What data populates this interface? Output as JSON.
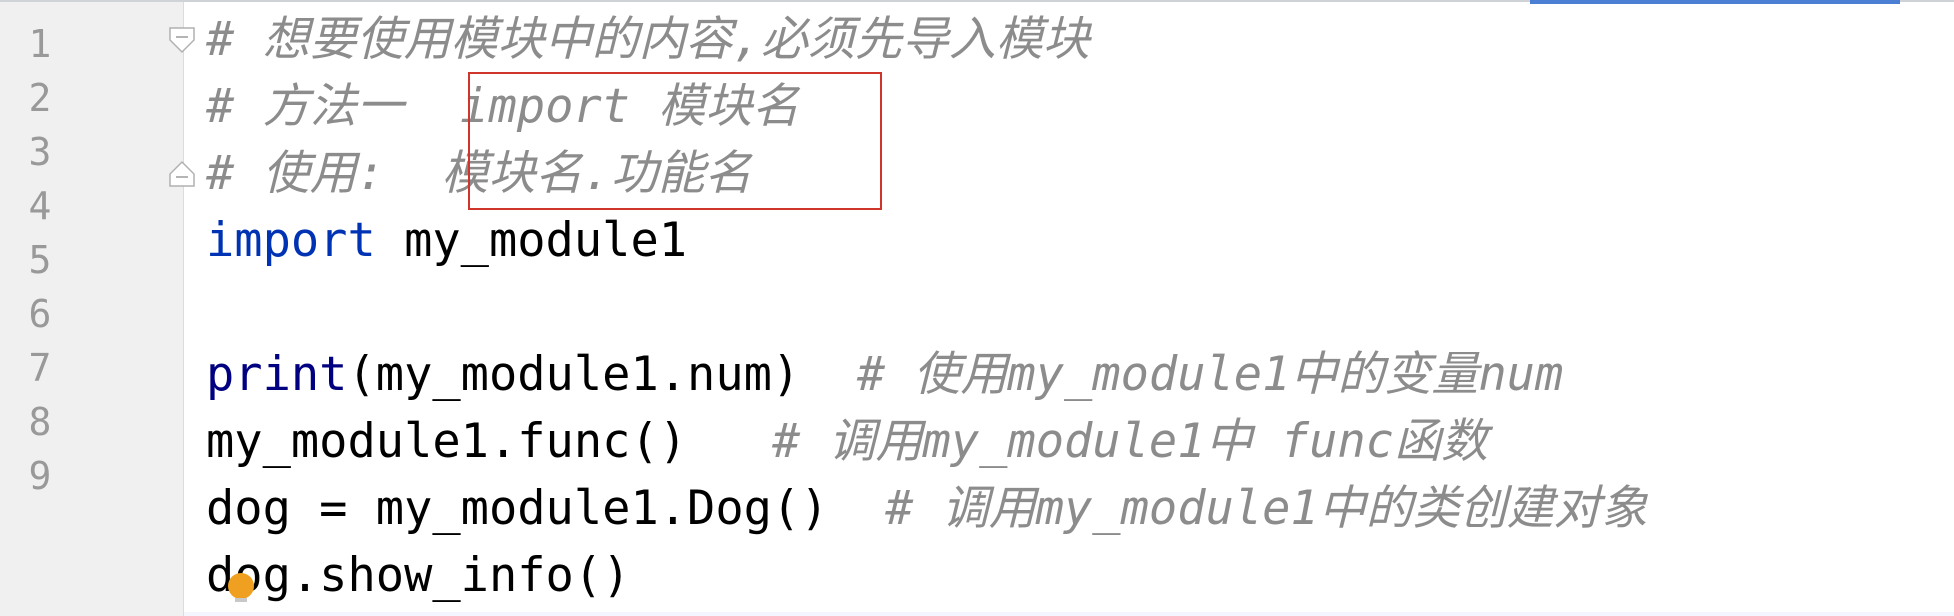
{
  "editor": {
    "line_numbers": [
      "1",
      "2",
      "3",
      "4",
      "5",
      "6",
      "7",
      "8",
      "9"
    ],
    "lines": [
      {
        "segments": [
          {
            "kind": "comment",
            "text": "# 想要使用模块中的内容,必须先导入模块"
          }
        ]
      },
      {
        "segments": [
          {
            "kind": "comment",
            "text": "# 方法一  import 模块名"
          }
        ]
      },
      {
        "segments": [
          {
            "kind": "comment",
            "text": "# 使用:  模块名.功能名"
          }
        ]
      },
      {
        "segments": [
          {
            "kind": "keyword",
            "text": "import"
          },
          {
            "kind": "plain",
            "text": " my_module1"
          }
        ]
      },
      {
        "segments": []
      },
      {
        "segments": [
          {
            "kind": "builtin",
            "text": "print"
          },
          {
            "kind": "plain",
            "text": "(my_module1.num)  "
          },
          {
            "kind": "comment",
            "text": "# 使用my_module1中的变量num"
          }
        ]
      },
      {
        "segments": [
          {
            "kind": "plain",
            "text": "my_module1.func()   "
          },
          {
            "kind": "comment",
            "text": "# 调用my_module1中 func函数"
          }
        ]
      },
      {
        "segments": [
          {
            "kind": "plain",
            "text": "dog = my_module1.Dog()  "
          },
          {
            "kind": "comment",
            "text": "# 调用my_module1中的类创建对象"
          }
        ]
      },
      {
        "segments": [
          {
            "kind": "plain",
            "text": "dog.show_info()"
          }
        ]
      }
    ],
    "fold_marker_lines": [
      1,
      3
    ],
    "icons": {
      "bulb": "lightbulb-icon",
      "fold": "fold-marker-icon"
    },
    "colors": {
      "comment": "#8c8c8c",
      "keyword": "#0033b3",
      "builtin": "#000080",
      "highlight_box": "#d0352b",
      "bulb": "#f0a020"
    }
  }
}
